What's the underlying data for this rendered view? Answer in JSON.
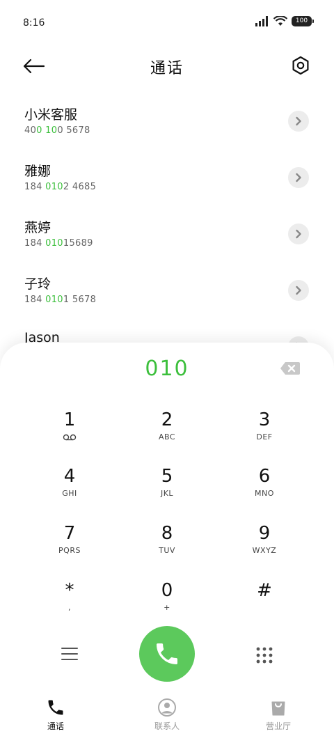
{
  "status_bar": {
    "time": "8:16",
    "battery": "100"
  },
  "header": {
    "title": "通话"
  },
  "contacts": [
    {
      "name": "小米客服",
      "number_parts": [
        "40",
        "0",
        " ",
        "10",
        "0 5678"
      ]
    },
    {
      "name": "雅娜",
      "number_parts": [
        "184 ",
        "010",
        "2 4685"
      ]
    },
    {
      "name": "燕婷",
      "number_parts": [
        "184 ",
        "010",
        "15689"
      ]
    },
    {
      "name": "子玲",
      "number_parts": [
        "184 ",
        "010",
        "1 5678"
      ]
    },
    {
      "name": "Jason",
      "number_parts": []
    }
  ],
  "dialer": {
    "display": "010",
    "keys": [
      {
        "digit": "1",
        "letters": "",
        "icon": "voicemail-icon"
      },
      {
        "digit": "2",
        "letters": "ABC"
      },
      {
        "digit": "3",
        "letters": "DEF"
      },
      {
        "digit": "4",
        "letters": "GHI"
      },
      {
        "digit": "5",
        "letters": "JKL"
      },
      {
        "digit": "6",
        "letters": "MNO"
      },
      {
        "digit": "7",
        "letters": "PQRS"
      },
      {
        "digit": "8",
        "letters": "TUV"
      },
      {
        "digit": "9",
        "letters": "WXYZ"
      },
      {
        "digit": "*",
        "letters": ","
      },
      {
        "digit": "0",
        "letters": "+"
      },
      {
        "digit": "#",
        "letters": ""
      }
    ]
  },
  "bottom_nav": {
    "items": [
      {
        "label": "通话",
        "icon": "phone-icon",
        "active": true
      },
      {
        "label": "联系人",
        "icon": "contacts-icon",
        "active": false
      },
      {
        "label": "营业厅",
        "icon": "shopping-bag-icon",
        "active": false
      }
    ]
  },
  "colors": {
    "accent": "#3cbf3c",
    "call_button": "#5cc95c"
  }
}
